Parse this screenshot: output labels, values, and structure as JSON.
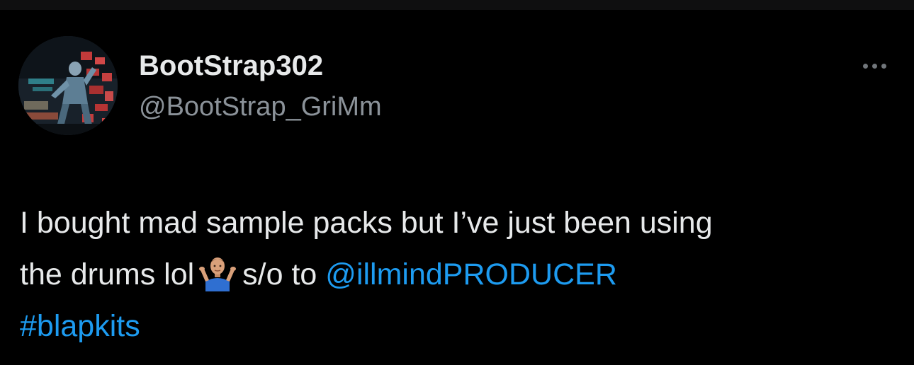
{
  "tweet": {
    "author": {
      "display_name": "BootStrap302",
      "handle": "@BootStrap_GriMm",
      "avatar": "avatar-photo-performer-stage"
    },
    "more_icon": "more-horizontal-icon",
    "text": {
      "line1": "I bought mad sample packs but I’ve just been using",
      "line2_before": "the drums lol",
      "emoji": "person-shrugging-emoji",
      "line2_after": "s/o to",
      "mention": "@illmindPRODUCER",
      "hashtag": "#blapkits"
    },
    "colors": {
      "background": "#000000",
      "text": "#e7e9ea",
      "secondary_text": "#8b9299",
      "link": "#1d9bf0"
    }
  }
}
